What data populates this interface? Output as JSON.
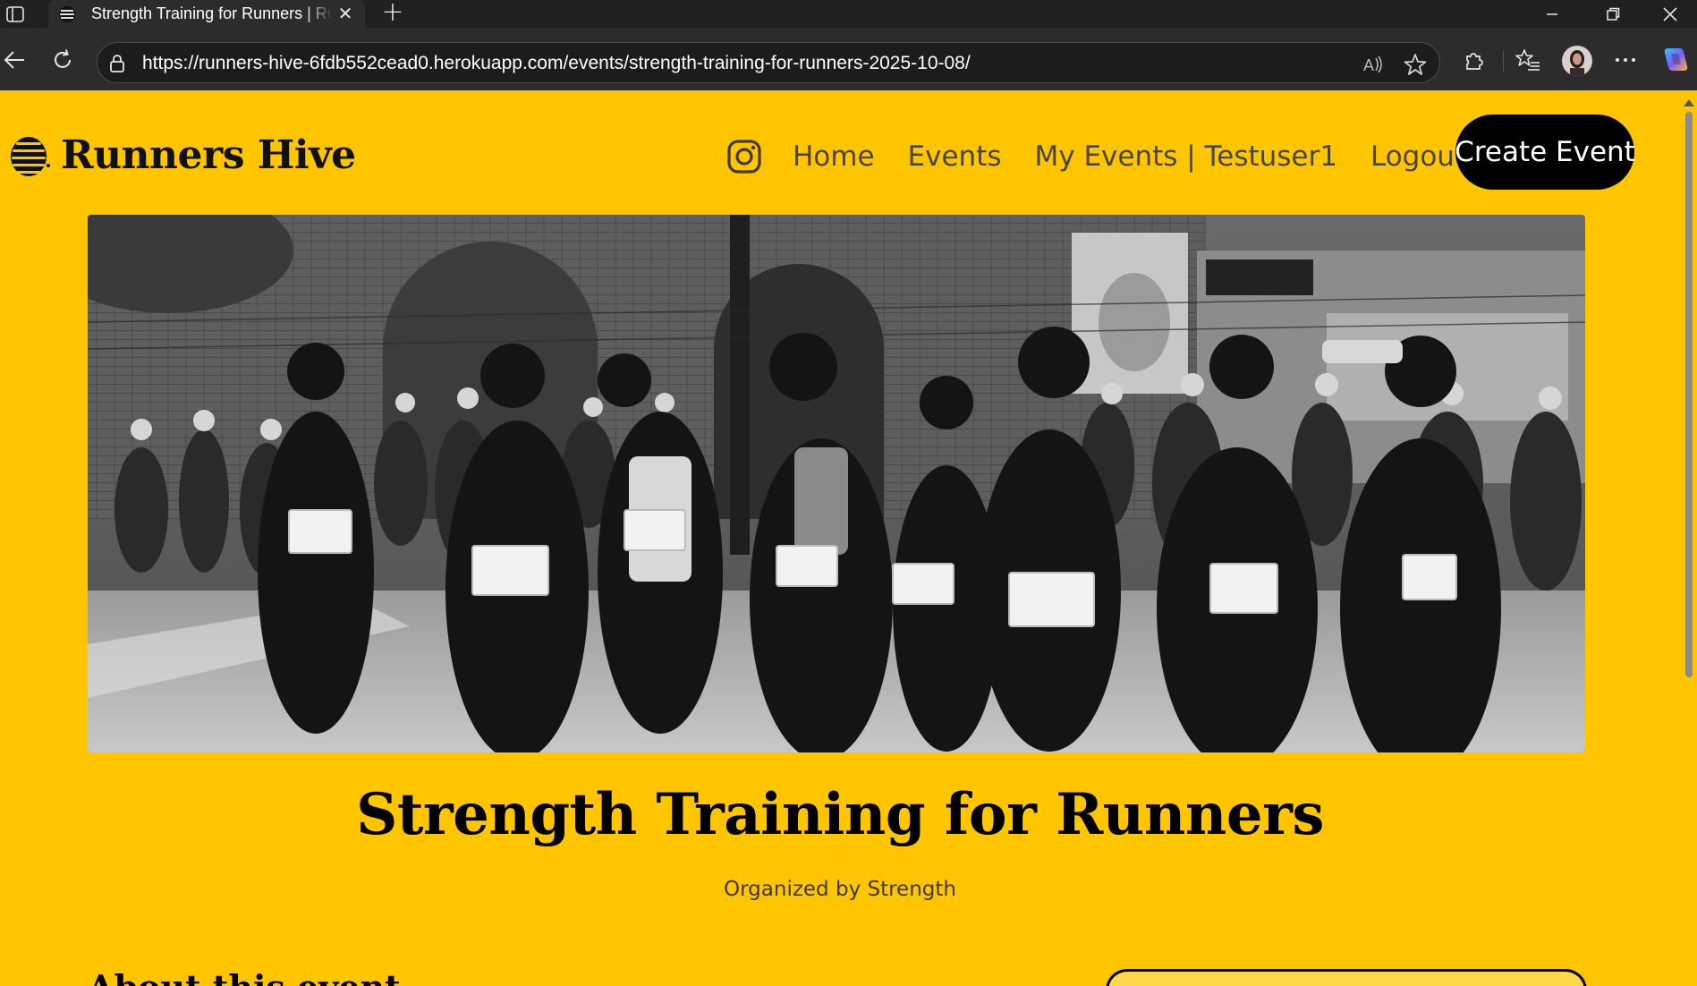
{
  "browser": {
    "tab_title": "Strength Training for Runners | Runners Hive",
    "url": "https://runners-hive-6fdb552cead0.herokuapp.com/events/strength-training-for-runners-2025-10-08/",
    "icons": [
      "tab-actions-icon",
      "close-icon",
      "plus-icon",
      "minimize-icon",
      "restore-icon",
      "close-window-icon",
      "back-arrow-icon",
      "refresh-icon",
      "lock-icon",
      "read-aloud-icon",
      "star-icon",
      "extensions-icon",
      "favorites-icon",
      "avatar",
      "more-icon",
      "copilot-icon"
    ]
  },
  "site": {
    "brand": "Runners Hive",
    "nav": {
      "home": "Home",
      "events": "Events",
      "my_events": "My Events | Testuser1",
      "logout": "Logout",
      "create_event": "Create Event"
    },
    "colors": {
      "background": "#ffc600",
      "button": "#000000",
      "button_text": "#ffffff"
    }
  },
  "event": {
    "title": "Strength Training for Runners",
    "organizer": "Organized by Strength",
    "about_heading": "About this event",
    "hero_image": "black-and-white photo of marathon runners racing past cheering spectators"
  }
}
